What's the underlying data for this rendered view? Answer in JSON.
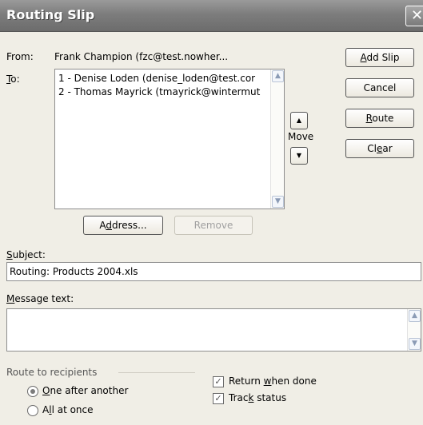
{
  "window": {
    "title": "Routing Slip",
    "close_glyph": "✕"
  },
  "from": {
    "label": "From:",
    "value": "Frank Champion (fzc@test.nowher..."
  },
  "to": {
    "label_pre": "",
    "label_mnemonic": "T",
    "label_post": "o:",
    "recipients": [
      "1 - Denise Loden (denise_loden@test.cor",
      "2 - Thomas Mayrick (tmayrick@wintermut"
    ]
  },
  "move": {
    "label": "Move",
    "up_glyph": "▲",
    "down_glyph": "▼"
  },
  "buttons": {
    "add_slip": {
      "pre": "",
      "mn": "A",
      "post": "dd Slip"
    },
    "cancel": {
      "label": "Cancel"
    },
    "route": {
      "pre": "",
      "mn": "R",
      "post": "oute"
    },
    "clear": {
      "pre": "Cl",
      "mn": "e",
      "post": "ar"
    },
    "address": {
      "pre": "A",
      "mn": "d",
      "post": "dress..."
    },
    "remove": {
      "label": "Remove"
    }
  },
  "subject": {
    "label_pre": "",
    "label_mnemonic": "S",
    "label_post": "ubject:",
    "value": "Routing: Products 2004.xls"
  },
  "message": {
    "label_pre": "",
    "label_mnemonic": "M",
    "label_post": "essage text:",
    "value": ""
  },
  "route_to": {
    "heading": "Route to recipients",
    "options": [
      {
        "pre": "",
        "mn": "O",
        "post": "ne after another",
        "checked": true
      },
      {
        "pre": "A",
        "mn": "l",
        "post": "l at once",
        "checked": false
      }
    ]
  },
  "options": {
    "return_when_done": {
      "pre": "Return ",
      "mn": "w",
      "post": "hen done",
      "checked": true
    },
    "track_status": {
      "pre": "Trac",
      "mn": "k",
      "post": " status",
      "checked": true
    }
  },
  "scroll": {
    "up_glyph": "▲",
    "down_glyph": "▼"
  }
}
